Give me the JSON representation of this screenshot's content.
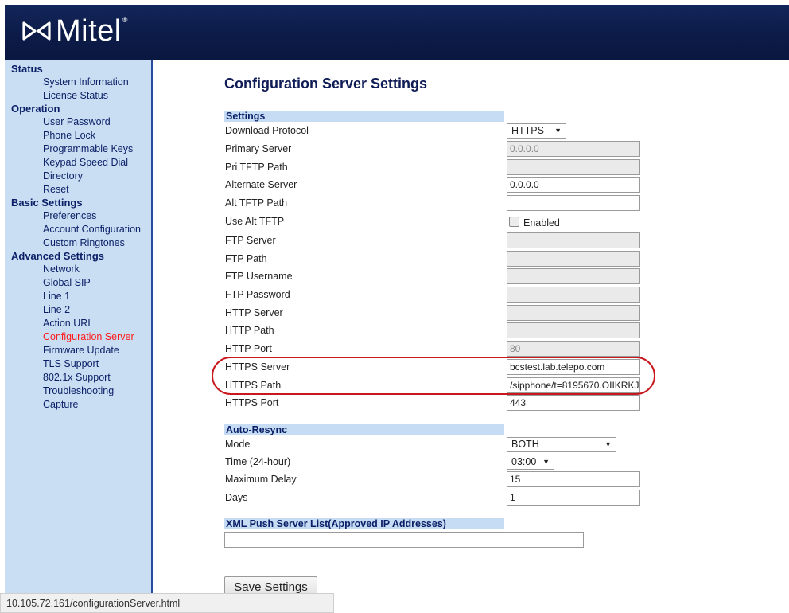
{
  "header": {
    "brand": "Mitel",
    "reg_mark": "®"
  },
  "sidebar": {
    "sections": [
      {
        "title": "Status",
        "items": [
          "System Information",
          "License Status"
        ]
      },
      {
        "title": "Operation",
        "items": [
          "User Password",
          "Phone Lock",
          "Programmable Keys",
          "Keypad Speed Dial",
          "Directory",
          "Reset"
        ]
      },
      {
        "title": "Basic Settings",
        "items": [
          "Preferences",
          "Account Configuration",
          "Custom Ringtones"
        ]
      },
      {
        "title": "Advanced Settings",
        "items": [
          "Network",
          "Global SIP",
          "Line 1",
          "Line 2",
          "Action URI",
          "Configuration Server",
          "Firmware Update",
          "TLS Support",
          "802.1x Support",
          "Troubleshooting",
          "Capture"
        ]
      }
    ],
    "active_item": "Configuration Server"
  },
  "page_title": "Configuration Server Settings",
  "settings": {
    "heading": "Settings",
    "download_protocol": {
      "label": "Download Protocol",
      "value": "HTTPS"
    },
    "primary_server": {
      "label": "Primary Server",
      "value": "0.0.0.0"
    },
    "pri_tftp_path": {
      "label": "Pri TFTP Path",
      "value": ""
    },
    "alternate_server": {
      "label": "Alternate Server",
      "value": "0.0.0.0"
    },
    "alt_tftp_path": {
      "label": "Alt TFTP Path",
      "value": ""
    },
    "use_alt_tftp": {
      "label": "Use Alt TFTP",
      "checkbox_label": "Enabled"
    },
    "ftp_server": {
      "label": "FTP Server",
      "value": ""
    },
    "ftp_path": {
      "label": "FTP Path",
      "value": ""
    },
    "ftp_username": {
      "label": "FTP Username",
      "value": ""
    },
    "ftp_password": {
      "label": "FTP Password",
      "value": ""
    },
    "http_server": {
      "label": "HTTP Server",
      "value": ""
    },
    "http_path": {
      "label": "HTTP Path",
      "value": ""
    },
    "http_port": {
      "label": "HTTP Port",
      "value": "80"
    },
    "https_server": {
      "label": "HTTPS Server",
      "value": "bcstest.lab.telepo.com"
    },
    "https_path": {
      "label": "HTTPS Path",
      "value": "/sipphone/t=8195670.OIIKRKJ"
    },
    "https_port": {
      "label": "HTTPS Port",
      "value": "443"
    }
  },
  "auto_resync": {
    "heading": "Auto-Resync",
    "mode": {
      "label": "Mode",
      "value": "BOTH"
    },
    "time": {
      "label": "Time (24-hour)",
      "value": "03:00"
    },
    "max_delay": {
      "label": "Maximum Delay",
      "value": "15"
    },
    "days": {
      "label": "Days",
      "value": "1"
    }
  },
  "xml_push": {
    "heading": "XML Push Server List(Approved IP Addresses)",
    "value": ""
  },
  "save_label": "Save Settings",
  "status_bar": "10.105.72.161/configurationServer.html",
  "colors": {
    "header": "#0c1b48",
    "sidebar": "#c9def3",
    "active_nav": "#ff1a1a",
    "highlight": "#c8181e"
  }
}
